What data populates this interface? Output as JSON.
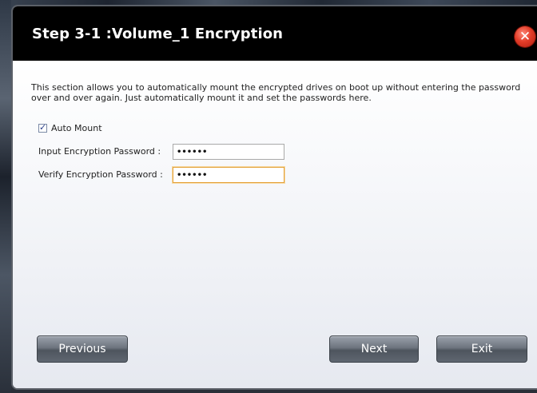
{
  "dialog": {
    "title": "Step 3-1 :Volume_1 Encryption",
    "close_symbol": "✕",
    "description": "This section allows you to automatically mount the encrypted drives on boot up without entering the password over and over again. Just automatically mount it and set the passwords here.",
    "auto_mount": {
      "label": "Auto Mount",
      "checked": true
    },
    "input_password": {
      "label": "Input Encryption Password :",
      "value": "••••••"
    },
    "verify_password": {
      "label": "Verify Encryption Password :",
      "value": "••••••"
    },
    "buttons": {
      "previous": "Previous",
      "next": "Next",
      "exit": "Exit"
    }
  },
  "colors": {
    "title_bar": "#000000",
    "close_button": "#e23c28",
    "focus_border": "#e4a23b",
    "button": "#6d747e"
  },
  "icons": {
    "close": "close-icon",
    "checkbox": "checkbox-checked-icon"
  }
}
